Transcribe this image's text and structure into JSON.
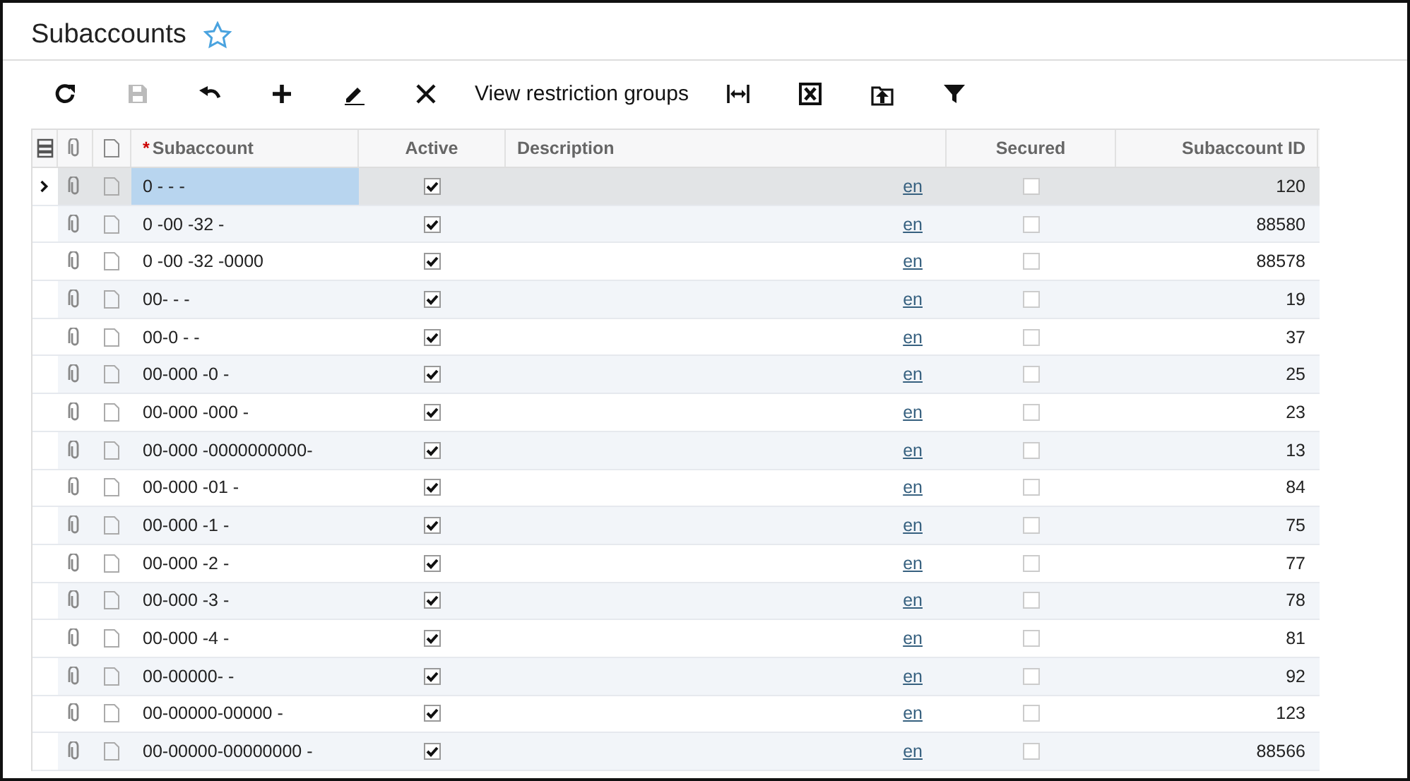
{
  "title": "Subaccounts",
  "favorite": false,
  "toolbar": [
    {
      "kind": "refresh",
      "disabled": false
    },
    {
      "kind": "save",
      "disabled": true
    },
    {
      "kind": "undo",
      "disabled": false
    },
    {
      "kind": "add",
      "disabled": false
    },
    {
      "kind": "edit",
      "disabled": false
    },
    {
      "kind": "delete",
      "disabled": false
    },
    {
      "kind": "text",
      "label": "View restriction groups",
      "disabled": false
    },
    {
      "kind": "fit",
      "disabled": false
    },
    {
      "kind": "export",
      "disabled": false
    },
    {
      "kind": "upload",
      "disabled": false
    },
    {
      "kind": "filter",
      "disabled": false
    }
  ],
  "columns": [
    {
      "label": "Subaccount",
      "required_mark": "*"
    },
    {
      "label": "Active"
    },
    {
      "label": "Description"
    },
    {
      "label": "Secured"
    },
    {
      "label": "Subaccount ID"
    }
  ],
  "rows": [
    {
      "subaccount": "0 - - -",
      "active": true,
      "language": "en",
      "secured": false,
      "id": "120",
      "selected": true
    },
    {
      "subaccount": "0 -00 -32 -",
      "active": true,
      "language": "en",
      "secured": false,
      "id": "88580",
      "selected": false
    },
    {
      "subaccount": "0 -00 -32 -0000",
      "active": true,
      "language": "en",
      "secured": false,
      "id": "88578",
      "selected": false
    },
    {
      "subaccount": "00- - -",
      "active": true,
      "language": "en",
      "secured": false,
      "id": "19",
      "selected": false
    },
    {
      "subaccount": "00-0 - -",
      "active": true,
      "language": "en",
      "secured": false,
      "id": "37",
      "selected": false
    },
    {
      "subaccount": "00-000 -0 -",
      "active": true,
      "language": "en",
      "secured": false,
      "id": "25",
      "selected": false
    },
    {
      "subaccount": "00-000 -000 -",
      "active": true,
      "language": "en",
      "secured": false,
      "id": "23",
      "selected": false
    },
    {
      "subaccount": "00-000 -0000000000-",
      "active": true,
      "language": "en",
      "secured": false,
      "id": "13",
      "selected": false
    },
    {
      "subaccount": "00-000 -01 -",
      "active": true,
      "language": "en",
      "secured": false,
      "id": "84",
      "selected": false
    },
    {
      "subaccount": "00-000 -1 -",
      "active": true,
      "language": "en",
      "secured": false,
      "id": "75",
      "selected": false
    },
    {
      "subaccount": "00-000 -2 -",
      "active": true,
      "language": "en",
      "secured": false,
      "id": "77",
      "selected": false
    },
    {
      "subaccount": "00-000 -3 -",
      "active": true,
      "language": "en",
      "secured": false,
      "id": "78",
      "selected": false
    },
    {
      "subaccount": "00-000 -4 -",
      "active": true,
      "language": "en",
      "secured": false,
      "id": "81",
      "selected": false
    },
    {
      "subaccount": "00-00000- -",
      "active": true,
      "language": "en",
      "secured": false,
      "id": "92",
      "selected": false
    },
    {
      "subaccount": "00-00000-00000 -",
      "active": true,
      "language": "en",
      "secured": false,
      "id": "123",
      "selected": false
    },
    {
      "subaccount": "00-00000-00000000 -",
      "active": true,
      "language": "en",
      "secured": false,
      "id": "88566",
      "selected": false
    }
  ]
}
